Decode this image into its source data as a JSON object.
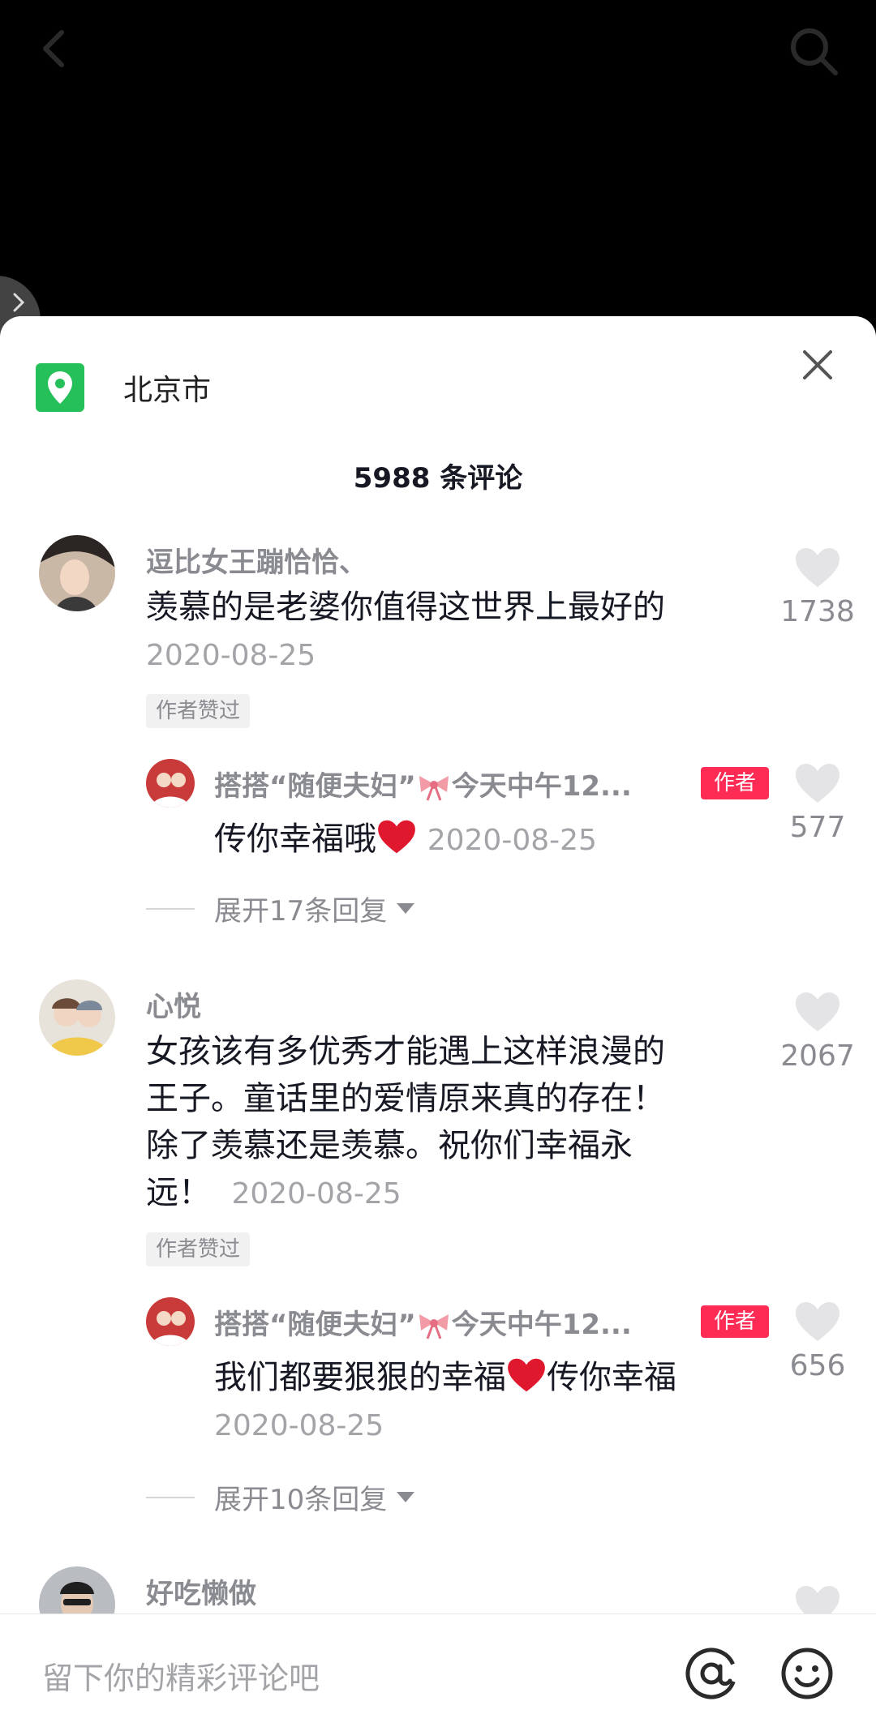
{
  "location": {
    "name": "北京市"
  },
  "comments_header": {
    "count_text": "5988 条评论"
  },
  "comments": [
    {
      "username": "逗比女王蹦恰恰、",
      "text": "羡慕的是老婆你值得这世界上最好的",
      "date": "2020-08-25",
      "author_liked_label": "作者赞过",
      "likes": "1738",
      "reply": {
        "username_prefix": "搭搭“随便夫妇”",
        "username_suffix": "今天中午12...",
        "author_label": "作者",
        "text": "传你幸福哦",
        "date": "2020-08-25",
        "likes": "577"
      },
      "expand_label": "展开17条回复"
    },
    {
      "username": "心悦",
      "text_lines": [
        "女孩该有多优秀才能遇上这样浪漫的",
        "王子。童话里的爱情原来真的存在！",
        "除了羡慕还是羡慕。祝你们幸福永",
        "远！"
      ],
      "date": "2020-08-25",
      "author_liked_label": "作者赞过",
      "likes": "2067",
      "reply": {
        "username_prefix": "搭搭“随便夫妇”",
        "username_suffix": "今天中午12...",
        "author_label": "作者",
        "text_before": "我们都要狠狠的幸福",
        "text_after": "传你幸福",
        "date": "2020-08-25",
        "likes": "656"
      },
      "expand_label": "展开10条回复"
    },
    {
      "username": "好吃懒做"
    }
  ],
  "input": {
    "placeholder": "留下你的精彩评论吧"
  },
  "colors": {
    "accent": "#fe2c55",
    "location_green": "#25c05a",
    "heart_red": "#e0182d"
  }
}
